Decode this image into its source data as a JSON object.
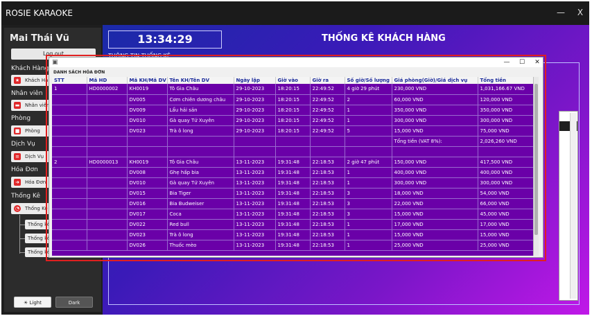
{
  "window": {
    "title": "ROSIE KARAOKE",
    "minimize": "—",
    "close": "X"
  },
  "sidebar": {
    "user_name": "Mai Thái Vũ",
    "logout_label": "Log out",
    "sections": [
      {
        "label": "Khách Hàng",
        "button": "Khách Hàng",
        "icon": "star-icon"
      },
      {
        "label": "Nhân viên",
        "button": "Nhân viên",
        "icon": "id-card-icon"
      },
      {
        "label": "Phòng",
        "button": "Phòng",
        "icon": "room-icon"
      },
      {
        "label": "Dịch Vụ",
        "button": "Dịch Vụ",
        "icon": "service-icon"
      },
      {
        "label": "Hóa Đơn",
        "button": "Hóa Đơn",
        "icon": "arrow-right-icon"
      },
      {
        "label": "Thống Kê",
        "button": "Thống Kê",
        "icon": "pie-chart-icon"
      }
    ],
    "sub_items": [
      "Thống kê",
      "Thống kê",
      "Thống kê"
    ],
    "light_label": "Light",
    "dark_label": "Dark"
  },
  "main": {
    "clock": "13:34:29",
    "heading": "THỐNG KÊ KHÁCH HÀNG",
    "info_label": "THÔNG TIN THỐNG KÊ"
  },
  "dialog": {
    "caption": "DANH SÁCH HÓA ĐƠN",
    "controls": {
      "minimize": "—",
      "maximize": "☐",
      "close": "✕"
    },
    "columns": [
      "STT",
      "Mã HD",
      "Mã KH/Mã DV",
      "Tên KH/Tên DV",
      "Ngày lập",
      "Giờ vào",
      "Giờ ra",
      "Số giờ/Số lượng",
      "Giá phòng(Giờ)/Giá dịch vụ",
      "Tổng tiền"
    ],
    "rows": [
      [
        "1",
        "HD0000002",
        "KH0019",
        "Tô Gia Châu",
        "29-10-2023",
        "18:20:15",
        "22:49:52",
        "4 giờ 29 phút",
        "230,000 VND",
        "1,031,166.67 VND"
      ],
      [
        "",
        "",
        "DV005",
        "Cơm chiên dương châu",
        "29-10-2023",
        "18:20:15",
        "22:49:52",
        "2",
        "60,000 VND",
        "120,000 VND"
      ],
      [
        "",
        "",
        "DV009",
        "Lẩu hải sản",
        "29-10-2023",
        "18:20:15",
        "22:49:52",
        "1",
        "350,000 VND",
        "350,000 VND"
      ],
      [
        "",
        "",
        "DV010",
        "Gà quay Tứ Xuyên",
        "29-10-2023",
        "18:20:15",
        "22:49:52",
        "1",
        "300,000 VND",
        "300,000 VND"
      ],
      [
        "",
        "",
        "DV023",
        "Trà ô long",
        "29-10-2023",
        "18:20:15",
        "22:49:52",
        "5",
        "15,000 VND",
        "75,000 VND"
      ],
      [
        "",
        "",
        "",
        "",
        "",
        "",
        "",
        "",
        "Tổng tiền (VAT 8%):",
        "2,026,260 VND"
      ],
      [
        "",
        "",
        "",
        "",
        "",
        "",
        "",
        "",
        "",
        ""
      ],
      [
        "2",
        "HD0000013",
        "KH0019",
        "Tô Gia Châu",
        "13-11-2023",
        "19:31:48",
        "22:18:53",
        "2 giờ 47 phút",
        "150,000 VND",
        "417,500 VND"
      ],
      [
        "",
        "",
        "DV008",
        "Ghẹ hấp bia",
        "13-11-2023",
        "19:31:48",
        "22:18:53",
        "1",
        "400,000 VND",
        "400,000 VND"
      ],
      [
        "",
        "",
        "DV010",
        "Gà quay Tứ Xuyên",
        "13-11-2023",
        "19:31:48",
        "22:18:53",
        "1",
        "300,000 VND",
        "300,000 VND"
      ],
      [
        "",
        "",
        "DV015",
        "Bia Tiger",
        "13-11-2023",
        "19:31:48",
        "22:18:53",
        "3",
        "18,000 VND",
        "54,000 VND"
      ],
      [
        "",
        "",
        "DV016",
        "Bia Budweiser",
        "13-11-2023",
        "19:31:48",
        "22:18:53",
        "3",
        "22,000 VND",
        "66,000 VND"
      ],
      [
        "",
        "",
        "DV017",
        "Coca",
        "13-11-2023",
        "19:31:48",
        "22:18:53",
        "3",
        "15,000 VND",
        "45,000 VND"
      ],
      [
        "",
        "",
        "DV022",
        "Red bull",
        "13-11-2023",
        "19:31:48",
        "22:18:53",
        "1",
        "17,000 VND",
        "17,000 VND"
      ],
      [
        "",
        "",
        "DV023",
        "Trà ô long",
        "13-11-2023",
        "19:31:48",
        "22:18:53",
        "1",
        "15,000 VND",
        "15,000 VND"
      ],
      [
        "",
        "",
        "DV026",
        "Thuốc mèo",
        "13-11-2023",
        "19:31:48",
        "22:18:53",
        "1",
        "25,000 VND",
        "25,000 VND"
      ]
    ]
  },
  "colors": {
    "table_bg": "#6a00a8",
    "header_text": "#1a2a9a",
    "highlight": "#e02020"
  }
}
